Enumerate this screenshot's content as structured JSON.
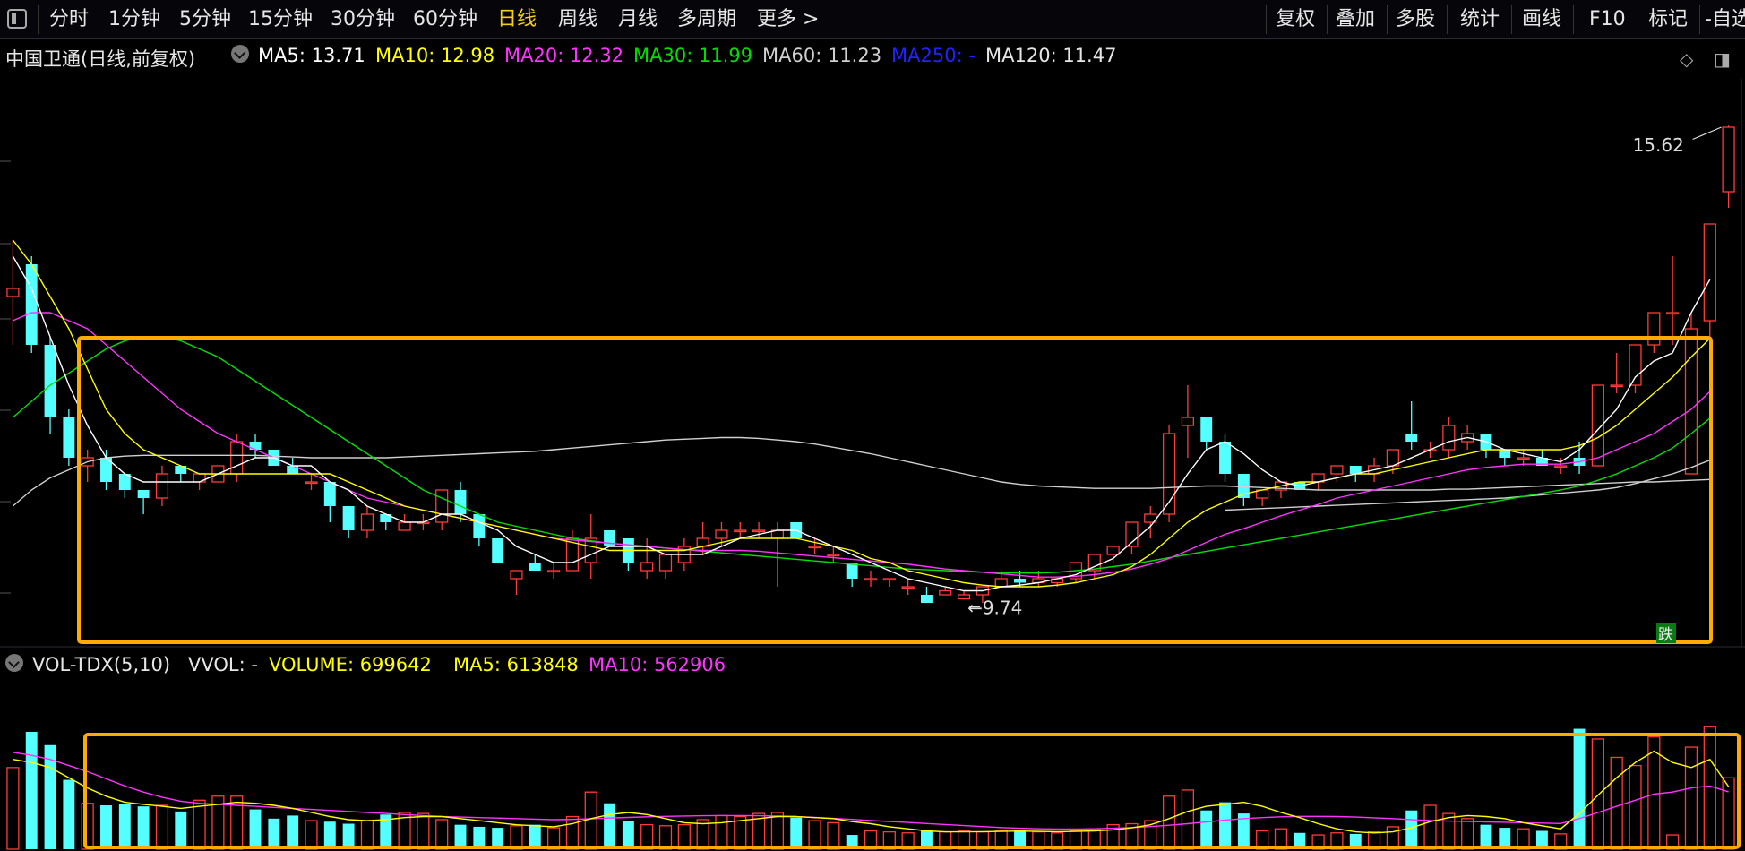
{
  "toolbar": {
    "items": [
      "分时",
      "1分钟",
      "5分钟",
      "15分钟",
      "30分钟",
      "60分钟",
      "日线",
      "周线",
      "月线",
      "多周期",
      "更多 >"
    ],
    "active": "日线",
    "right_items": [
      "复权",
      "叠加",
      "多股",
      "统计",
      "画线",
      "F10",
      "标记",
      "-自选"
    ]
  },
  "main_legend": {
    "title": "中国卫通(日线,前复权)",
    "ma5": "MA5: 13.71",
    "ma10": "MA10: 12.98",
    "ma20": "MA20: 12.32",
    "ma30": "MA30: 11.99",
    "ma60": "MA60: 11.23",
    "ma250": "MA250: -",
    "ma120": "MA120: 11.47"
  },
  "vol_legend": {
    "title": "VOL-TDX(5,10)",
    "vvol": "VVOL: -",
    "volume": "VOLUME: 699642",
    "ma5": "MA5: 613848",
    "ma10": "MA10: 562906"
  },
  "colors": {
    "up": "#ff3b3b",
    "down": "#53ffff",
    "ma5": "#ffffff",
    "ma10": "#ffff00",
    "ma20": "#ff33ff",
    "ma30": "#00e000",
    "ma60": "#d0d0d0",
    "ma250": "#2222ff",
    "highlight": "#ffaa00"
  },
  "chart_data": {
    "type": "candlestick",
    "price_range": [
      9.2,
      16.2
    ],
    "volume_range": [
      0,
      1650000
    ],
    "annotations": {
      "high_label": "15.62",
      "low_label": "9.74",
      "tag": "跌"
    },
    "candles": [
      [
        13.5,
        14.2,
        12.9,
        13.6
      ],
      [
        13.9,
        14.0,
        12.8,
        12.9
      ],
      [
        12.9,
        13.0,
        11.8,
        12.0
      ],
      [
        12.0,
        12.1,
        11.4,
        11.5
      ],
      [
        11.4,
        11.6,
        11.2,
        11.5
      ],
      [
        11.5,
        11.6,
        11.1,
        11.2
      ],
      [
        11.3,
        11.3,
        11.0,
        11.1
      ],
      [
        11.1,
        11.1,
        10.8,
        11.0
      ],
      [
        11.0,
        11.4,
        10.9,
        11.3
      ],
      [
        11.4,
        11.4,
        11.2,
        11.3
      ],
      [
        11.2,
        11.3,
        11.1,
        11.3
      ],
      [
        11.2,
        11.4,
        11.2,
        11.4
      ],
      [
        11.3,
        11.8,
        11.2,
        11.7
      ],
      [
        11.7,
        11.8,
        11.5,
        11.6
      ],
      [
        11.6,
        11.6,
        11.4,
        11.4
      ],
      [
        11.4,
        11.5,
        11.3,
        11.3
      ],
      [
        11.2,
        11.3,
        11.1,
        11.2
      ],
      [
        11.2,
        11.2,
        10.7,
        10.9
      ],
      [
        10.9,
        10.9,
        10.5,
        10.6
      ],
      [
        10.6,
        10.9,
        10.5,
        10.8
      ],
      [
        10.8,
        10.8,
        10.6,
        10.7
      ],
      [
        10.6,
        10.8,
        10.6,
        10.7
      ],
      [
        10.7,
        10.8,
        10.6,
        10.7
      ],
      [
        10.7,
        11.1,
        10.6,
        11.1
      ],
      [
        11.1,
        11.2,
        10.7,
        10.8
      ],
      [
        10.8,
        10.8,
        10.4,
        10.5
      ],
      [
        10.5,
        10.5,
        10.2,
        10.2
      ],
      [
        10.0,
        10.1,
        9.8,
        10.1
      ],
      [
        10.2,
        10.3,
        10.1,
        10.1
      ],
      [
        10.1,
        10.2,
        10.0,
        10.1
      ],
      [
        10.1,
        10.6,
        10.1,
        10.5
      ],
      [
        10.2,
        10.8,
        10.0,
        10.5
      ],
      [
        10.6,
        10.6,
        10.4,
        10.4
      ],
      [
        10.5,
        10.5,
        10.1,
        10.2
      ],
      [
        10.1,
        10.5,
        10.0,
        10.2
      ],
      [
        10.1,
        10.3,
        10.0,
        10.3
      ],
      [
        10.2,
        10.5,
        10.1,
        10.4
      ],
      [
        10.4,
        10.7,
        10.3,
        10.5
      ],
      [
        10.5,
        10.7,
        10.4,
        10.6
      ],
      [
        10.6,
        10.7,
        10.5,
        10.6
      ],
      [
        10.6,
        10.7,
        10.5,
        10.6
      ],
      [
        10.5,
        10.7,
        9.9,
        10.6
      ],
      [
        10.7,
        10.7,
        10.5,
        10.5
      ],
      [
        10.4,
        10.5,
        10.3,
        10.4
      ],
      [
        10.3,
        10.4,
        10.2,
        10.3
      ],
      [
        10.2,
        10.2,
        9.9,
        10.0
      ],
      [
        10.0,
        10.1,
        9.9,
        10.0
      ],
      [
        10.0,
        10.0,
        9.9,
        10.0
      ],
      [
        9.9,
        10.0,
        9.8,
        9.9
      ],
      [
        9.8,
        9.9,
        9.7,
        9.7
      ],
      [
        9.8,
        9.9,
        9.8,
        9.85
      ],
      [
        9.75,
        9.85,
        9.74,
        9.8
      ],
      [
        9.8,
        9.9,
        9.7,
        9.9
      ],
      [
        9.9,
        10.1,
        9.9,
        10.0
      ],
      [
        10.0,
        10.1,
        9.9,
        9.95
      ],
      [
        9.95,
        10.1,
        9.9,
        10.0
      ],
      [
        9.95,
        10.0,
        9.9,
        10.0
      ],
      [
        10.0,
        10.2,
        9.95,
        10.2
      ],
      [
        10.1,
        10.3,
        10.0,
        10.3
      ],
      [
        10.3,
        10.4,
        10.2,
        10.4
      ],
      [
        10.4,
        10.7,
        10.3,
        10.7
      ],
      [
        10.7,
        10.9,
        10.5,
        10.8
      ],
      [
        10.8,
        11.9,
        10.7,
        11.8
      ],
      [
        11.9,
        12.4,
        11.5,
        12.0
      ],
      [
        12.0,
        12.0,
        11.6,
        11.7
      ],
      [
        11.7,
        11.8,
        11.2,
        11.3
      ],
      [
        11.3,
        11.3,
        10.9,
        11.0
      ],
      [
        11.0,
        11.1,
        10.9,
        11.1
      ],
      [
        11.1,
        11.2,
        11.0,
        11.2
      ],
      [
        11.2,
        11.2,
        11.1,
        11.1
      ],
      [
        11.2,
        11.3,
        11.1,
        11.3
      ],
      [
        11.3,
        11.4,
        11.2,
        11.4
      ],
      [
        11.4,
        11.4,
        11.2,
        11.3
      ],
      [
        11.3,
        11.5,
        11.2,
        11.4
      ],
      [
        11.4,
        11.6,
        11.3,
        11.6
      ],
      [
        11.8,
        12.2,
        11.6,
        11.7
      ],
      [
        11.6,
        11.7,
        11.5,
        11.6
      ],
      [
        11.6,
        12.0,
        11.5,
        11.9
      ],
      [
        11.7,
        11.9,
        11.6,
        11.8
      ],
      [
        11.8,
        11.8,
        11.5,
        11.6
      ],
      [
        11.6,
        11.6,
        11.4,
        11.5
      ],
      [
        11.5,
        11.6,
        11.4,
        11.5
      ],
      [
        11.5,
        11.6,
        11.4,
        11.4
      ],
      [
        11.4,
        11.5,
        11.3,
        11.4
      ],
      [
        11.5,
        11.7,
        11.3,
        11.4
      ],
      [
        11.4,
        12.4,
        11.4,
        12.4
      ],
      [
        12.4,
        12.8,
        12.3,
        12.4
      ],
      [
        12.4,
        12.9,
        12.3,
        12.9
      ],
      [
        12.9,
        13.3,
        12.8,
        13.3
      ],
      [
        13.3,
        14.0,
        12.9,
        13.3
      ],
      [
        11.3,
        13.3,
        11.3,
        13.1
      ],
      [
        13.2,
        14.4,
        13.0,
        14.4
      ],
      [
        14.8,
        15.62,
        14.6,
        15.6
      ]
    ],
    "volume": [
      800000,
      1150000,
      1020000,
      680000,
      450000,
      430000,
      440000,
      420000,
      430000,
      370000,
      480000,
      520000,
      520000,
      390000,
      300000,
      330000,
      280000,
      270000,
      250000,
      280000,
      340000,
      360000,
      350000,
      290000,
      240000,
      220000,
      210000,
      230000,
      240000,
      210000,
      320000,
      560000,
      450000,
      280000,
      240000,
      230000,
      240000,
      290000,
      330000,
      320000,
      350000,
      360000,
      310000,
      280000,
      260000,
      140000,
      180000,
      170000,
      160000,
      180000,
      170000,
      180000,
      170000,
      180000,
      190000,
      170000,
      160000,
      180000,
      200000,
      240000,
      250000,
      280000,
      520000,
      580000,
      380000,
      460000,
      350000,
      180000,
      200000,
      160000,
      140000,
      160000,
      150000,
      170000,
      220000,
      380000,
      430000,
      350000,
      300000,
      240000,
      210000,
      200000,
      180000,
      150000,
      1180000,
      1080000,
      900000,
      820000,
      1100000,
      140000,
      1000000,
      1200000,
      700000
    ],
    "ma5": [
      14.0,
      13.6,
      13.0,
      12.4,
      11.9,
      11.5,
      11.3,
      11.2,
      11.2,
      11.2,
      11.2,
      11.3,
      11.4,
      11.5,
      11.5,
      11.4,
      11.4,
      11.2,
      11.1,
      10.9,
      10.8,
      10.7,
      10.7,
      10.8,
      10.8,
      10.7,
      10.6,
      10.4,
      10.3,
      10.2,
      10.2,
      10.3,
      10.4,
      10.4,
      10.4,
      10.3,
      10.3,
      10.3,
      10.4,
      10.5,
      10.55,
      10.6,
      10.6,
      10.5,
      10.4,
      10.3,
      10.2,
      10.1,
      10.0,
      9.95,
      9.9,
      9.85,
      9.85,
      9.9,
      9.92,
      9.95,
      10.0,
      10.05,
      10.15,
      10.25,
      10.45,
      10.65,
      10.95,
      11.3,
      11.6,
      11.7,
      11.55,
      11.35,
      11.2,
      11.15,
      11.2,
      11.25,
      11.3,
      11.35,
      11.4,
      11.5,
      11.6,
      11.7,
      11.75,
      11.7,
      11.6,
      11.55,
      11.5,
      11.45,
      11.6,
      11.85,
      12.1,
      12.5,
      12.7,
      12.8,
      13.3,
      13.71
    ],
    "ma10": [
      14.2,
      13.9,
      13.5,
      13.1,
      12.6,
      12.1,
      11.8,
      11.6,
      11.5,
      11.4,
      11.3,
      11.3,
      11.3,
      11.3,
      11.3,
      11.3,
      11.3,
      11.3,
      11.2,
      11.1,
      11.0,
      10.9,
      10.85,
      10.8,
      10.75,
      10.7,
      10.65,
      10.6,
      10.55,
      10.5,
      10.45,
      10.4,
      10.35,
      10.35,
      10.35,
      10.35,
      10.35,
      10.4,
      10.45,
      10.5,
      10.5,
      10.5,
      10.5,
      10.45,
      10.4,
      10.35,
      10.25,
      10.2,
      10.1,
      10.05,
      10.0,
      9.95,
      9.92,
      9.9,
      9.9,
      9.9,
      9.92,
      9.95,
      10.0,
      10.05,
      10.15,
      10.3,
      10.5,
      10.7,
      10.85,
      10.95,
      11.05,
      11.1,
      11.15,
      11.2,
      11.2,
      11.25,
      11.3,
      11.3,
      11.35,
      11.4,
      11.45,
      11.5,
      11.55,
      11.6,
      11.6,
      11.6,
      11.6,
      11.6,
      11.65,
      11.75,
      11.9,
      12.1,
      12.3,
      12.5,
      12.75,
      12.98
    ],
    "ma20": [
      13.2,
      13.3,
      13.3,
      13.2,
      13.1,
      12.9,
      12.7,
      12.5,
      12.3,
      12.1,
      11.95,
      11.8,
      11.7,
      11.6,
      11.5,
      11.4,
      11.3,
      11.2,
      11.1,
      11.0,
      10.95,
      10.9,
      10.85,
      10.8,
      10.75,
      10.7,
      10.65,
      10.6,
      10.55,
      10.5,
      10.48,
      10.46,
      10.44,
      10.42,
      10.4,
      10.38,
      10.36,
      10.35,
      10.35,
      10.35,
      10.34,
      10.32,
      10.3,
      10.28,
      10.26,
      10.24,
      10.22,
      10.2,
      10.18,
      10.15,
      10.12,
      10.1,
      10.08,
      10.06,
      10.04,
      10.02,
      10.02,
      10.03,
      10.05,
      10.08,
      10.12,
      10.18,
      10.25,
      10.35,
      10.45,
      10.55,
      10.62,
      10.7,
      10.78,
      10.85,
      10.92,
      11.0,
      11.05,
      11.1,
      11.15,
      11.2,
      11.25,
      11.3,
      11.35,
      11.38,
      11.4,
      11.42,
      11.42,
      11.42,
      11.45,
      11.5,
      11.6,
      11.7,
      11.8,
      11.95,
      12.1,
      12.32
    ],
    "ma30": [
      12.0,
      12.2,
      12.4,
      12.55,
      12.7,
      12.85,
      12.95,
      13.0,
      13.0,
      12.95,
      12.85,
      12.75,
      12.6,
      12.45,
      12.3,
      12.15,
      12.0,
      11.85,
      11.7,
      11.55,
      11.4,
      11.25,
      11.1,
      11.0,
      10.9,
      10.8,
      10.7,
      10.65,
      10.6,
      10.55,
      10.5,
      10.47,
      10.44,
      10.42,
      10.4,
      10.38,
      10.36,
      10.34,
      10.32,
      10.3,
      10.28,
      10.26,
      10.24,
      10.22,
      10.2,
      10.18,
      10.16,
      10.14,
      10.12,
      10.11,
      10.1,
      10.09,
      10.08,
      10.07,
      10.07,
      10.07,
      10.08,
      10.1,
      10.12,
      10.15,
      10.18,
      10.22,
      10.26,
      10.3,
      10.34,
      10.38,
      10.42,
      10.46,
      10.5,
      10.54,
      10.58,
      10.62,
      10.66,
      10.7,
      10.74,
      10.78,
      10.82,
      10.86,
      10.9,
      10.94,
      10.98,
      11.02,
      11.06,
      11.1,
      11.15,
      11.22,
      11.3,
      11.4,
      11.5,
      11.62,
      11.8,
      11.99
    ],
    "ma60": [
      10.9,
      11.1,
      11.25,
      11.35,
      11.45,
      11.5,
      11.52,
      11.53,
      11.53,
      11.53,
      11.53,
      11.53,
      11.53,
      11.53,
      11.52,
      11.51,
      11.5,
      11.5,
      11.5,
      11.5,
      11.5,
      11.51,
      11.52,
      11.53,
      11.54,
      11.55,
      11.56,
      11.57,
      11.58,
      11.6,
      11.62,
      11.64,
      11.66,
      11.68,
      11.7,
      11.72,
      11.73,
      11.74,
      11.75,
      11.75,
      11.74,
      11.72,
      11.7,
      11.67,
      11.63,
      11.59,
      11.55,
      11.5,
      11.45,
      11.4,
      11.35,
      11.3,
      11.25,
      11.2,
      11.17,
      11.15,
      11.14,
      11.13,
      11.12,
      11.12,
      11.12,
      11.12,
      11.13,
      11.14,
      11.15,
      11.15,
      11.14,
      11.13,
      11.12,
      11.11,
      11.1,
      11.1,
      11.1,
      11.1,
      11.1,
      11.1,
      11.1,
      11.11,
      11.11,
      11.12,
      11.13,
      11.14,
      11.15,
      11.16,
      11.17,
      11.18,
      11.19,
      11.2,
      11.2,
      11.21,
      11.22,
      11.23
    ],
    "ma120": [
      null,
      null,
      null,
      null,
      null,
      null,
      null,
      null,
      null,
      null,
      null,
      null,
      null,
      null,
      null,
      null,
      null,
      null,
      null,
      null,
      null,
      null,
      null,
      null,
      null,
      null,
      null,
      null,
      null,
      null,
      null,
      null,
      null,
      null,
      null,
      null,
      null,
      null,
      null,
      null,
      null,
      null,
      null,
      null,
      null,
      null,
      null,
      null,
      null,
      null,
      null,
      null,
      null,
      null,
      null,
      null,
      null,
      null,
      null,
      null,
      null,
      null,
      null,
      null,
      null,
      10.85,
      10.86,
      10.87,
      10.88,
      10.89,
      10.9,
      10.91,
      10.92,
      10.93,
      10.94,
      10.95,
      10.96,
      10.97,
      10.98,
      10.99,
      11.0,
      11.02,
      11.04,
      11.06,
      11.08,
      11.1,
      11.13,
      11.18,
      11.24,
      11.3,
      11.38,
      11.47
    ],
    "vol_ma5": [
      880000,
      850000,
      800000,
      700000,
      600000,
      520000,
      460000,
      440000,
      420000,
      400000,
      420000,
      440000,
      460000,
      450000,
      430000,
      400000,
      360000,
      320000,
      290000,
      280000,
      290000,
      310000,
      320000,
      320000,
      300000,
      280000,
      260000,
      240000,
      230000,
      220000,
      250000,
      300000,
      340000,
      360000,
      340000,
      300000,
      260000,
      250000,
      260000,
      280000,
      300000,
      320000,
      320000,
      310000,
      300000,
      270000,
      250000,
      220000,
      200000,
      180000,
      170000,
      170000,
      172000,
      175000,
      178000,
      175000,
      172000,
      175000,
      180000,
      190000,
      210000,
      240000,
      300000,
      370000,
      420000,
      440000,
      460000,
      420000,
      360000,
      310000,
      250000,
      200000,
      170000,
      160000,
      170000,
      210000,
      270000,
      310000,
      330000,
      320000,
      300000,
      260000,
      230000,
      200000,
      350000,
      530000,
      700000,
      850000,
      960000,
      850000,
      800000,
      880000,
      613848
    ],
    "vol_ma10": [
      950000,
      920000,
      880000,
      820000,
      760000,
      690000,
      620000,
      560000,
      510000,
      470000,
      450000,
      440000,
      430000,
      420000,
      410000,
      400000,
      390000,
      380000,
      370000,
      360000,
      350000,
      340000,
      330000,
      320000,
      315000,
      310000,
      305000,
      300000,
      295000,
      290000,
      292000,
      298000,
      305000,
      312000,
      318000,
      322000,
      326000,
      328000,
      330000,
      330000,
      328000,
      325000,
      320000,
      312000,
      302000,
      292000,
      282000,
      272000,
      262000,
      252000,
      242000,
      232000,
      222000,
      212000,
      205000,
      200000,
      198000,
      198000,
      200000,
      205000,
      212000,
      222000,
      235000,
      250000,
      268000,
      285000,
      300000,
      310000,
      318000,
      322000,
      322000,
      320000,
      315000,
      308000,
      300000,
      290000,
      282000,
      276000,
      272000,
      268000,
      264000,
      260000,
      256000,
      252000,
      300000,
      360000,
      420000,
      480000,
      540000,
      560000,
      600000,
      620000,
      562906
    ]
  }
}
